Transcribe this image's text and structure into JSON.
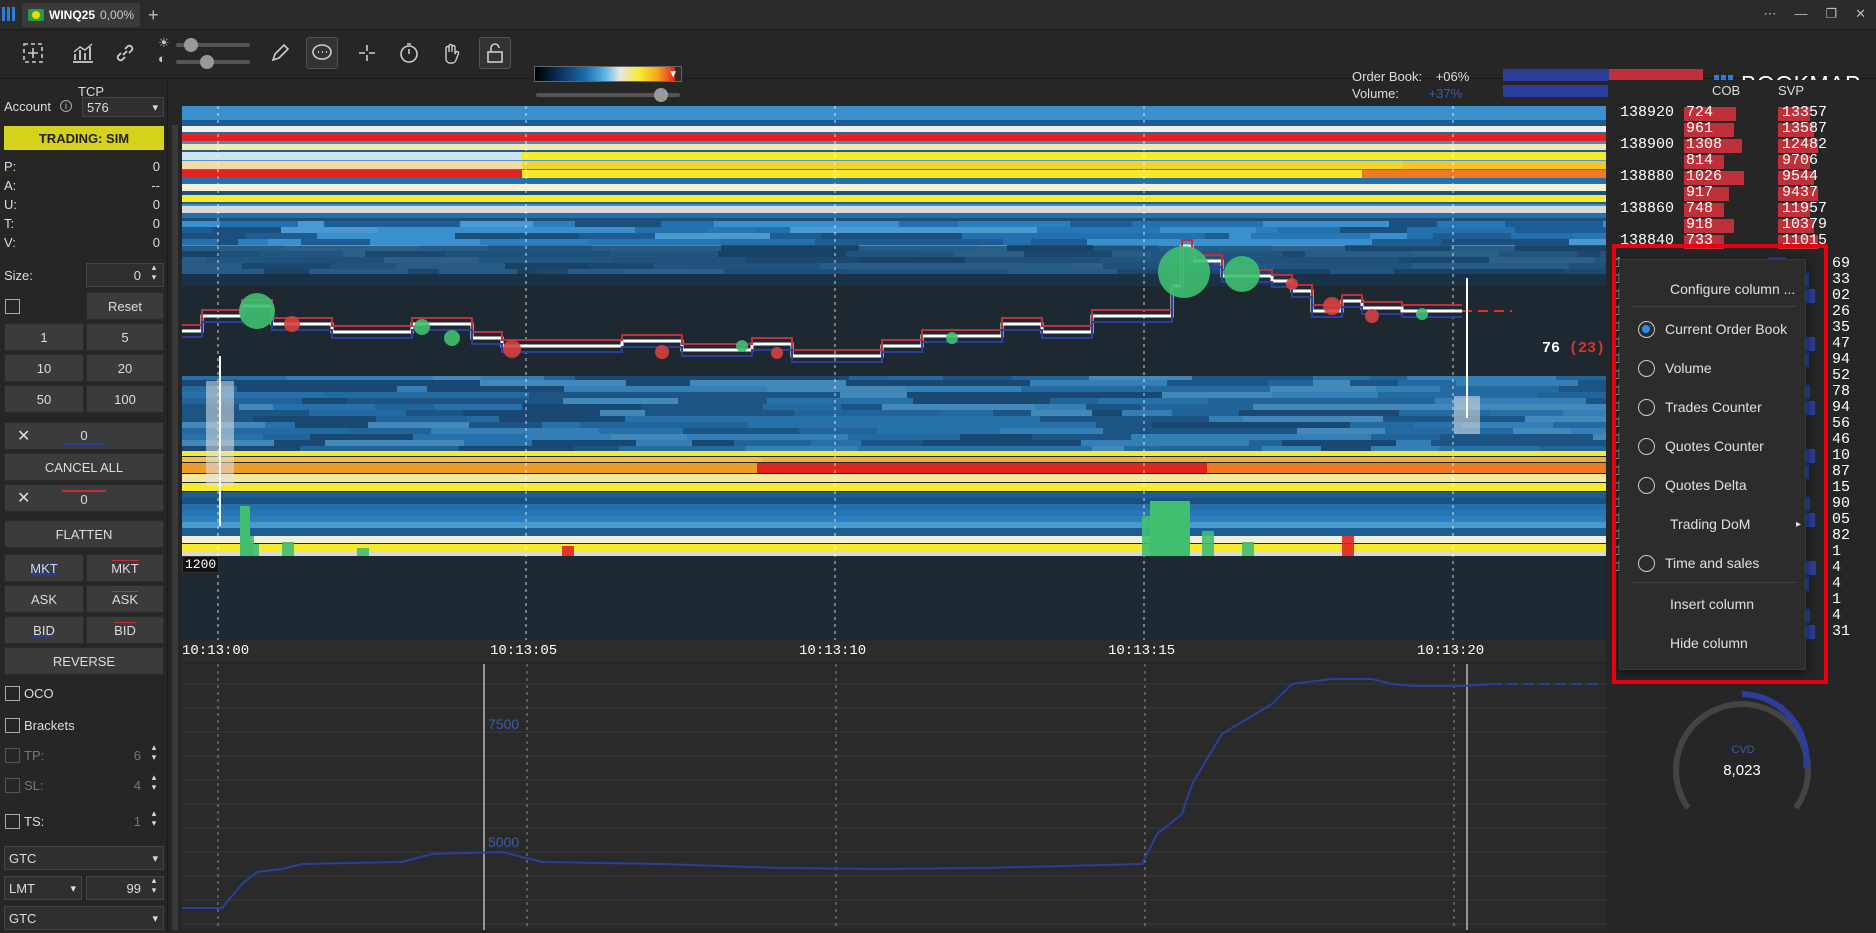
{
  "titlebar": {
    "instrument": "WINQ25",
    "change": "0,00%",
    "add_tab": "+"
  },
  "toolbar": {
    "order_book_label": "Order Book:",
    "order_book_value": "+06%",
    "volume_label": "Volume:",
    "volume_value": "+37%",
    "logo_text": "BOOKMAP"
  },
  "left_panel": {
    "tcp_label": "TCP",
    "account_label": "Account",
    "account_value": "576",
    "trading_mode": "TRADING: SIM",
    "stats": [
      {
        "label": "P:",
        "value": "0"
      },
      {
        "label": "A:",
        "value": "--"
      },
      {
        "label": "U:",
        "value": "0"
      },
      {
        "label": "T:",
        "value": "0"
      },
      {
        "label": "V:",
        "value": "0"
      }
    ],
    "size_label": "Size:",
    "size_value": "0",
    "reset_label": "Reset",
    "qty_buttons": [
      "1",
      "5",
      "10",
      "20",
      "50",
      "100"
    ],
    "cancel_buy_qty": "0",
    "cancel_all_label": "CANCEL ALL",
    "cancel_sell_qty": "0",
    "flatten_label": "FLATTEN",
    "mkt_label": "MKT",
    "ask_label": "ASK",
    "bid_label": "BID",
    "reverse_label": "REVERSE",
    "oco_label": "OCO",
    "brackets_label": "Brackets",
    "tp_label": "TP:",
    "tp_value": "6",
    "sl_label": "SL:",
    "sl_value": "4",
    "ts_label": "TS:",
    "ts_value": "1",
    "tif_top": "GTC",
    "order_type": "LMT",
    "offset": "99",
    "tif_bottom": "GTC"
  },
  "chart": {
    "volume_scale_label": "1200",
    "time_labels": [
      "10:13:00",
      "10:13:05",
      "10:13:10",
      "10:13:15",
      "10:13:20"
    ],
    "last_price_suffix": "76",
    "last_price_count": "(23)",
    "indicator_labels": [
      "7500",
      "5000"
    ]
  },
  "right_panel": {
    "cob_header": "COB",
    "svp_header": "SVP",
    "price_ladder": [
      {
        "price": "138920",
        "cob": "724",
        "svp": "13357"
      },
      {
        "price": "",
        "cob": "961",
        "svp": "13587"
      },
      {
        "price": "138900",
        "cob": "1308",
        "svp": "12482"
      },
      {
        "price": "",
        "cob": "814",
        "svp": "9706"
      },
      {
        "price": "138880",
        "cob": "1026",
        "svp": "9544"
      },
      {
        "price": "",
        "cob": "917",
        "svp": "9437"
      },
      {
        "price": "138860",
        "cob": "748",
        "svp": "11957"
      },
      {
        "price": "",
        "cob": "918",
        "svp": "10379"
      },
      {
        "price": "138840",
        "cob": "733",
        "svp": "11015"
      }
    ],
    "svp_partial": [
      "69",
      "33",
      "02",
      "26",
      "35",
      "47",
      "94",
      "52",
      "78",
      "94",
      "56",
      "46",
      "10",
      "87",
      "15",
      "90",
      "05",
      "82",
      "1",
      "4",
      "4",
      "1",
      "4",
      "31"
    ],
    "ladder_left_digit": "1",
    "cvd_label": "CVD",
    "cvd_value": "8,023"
  },
  "context_menu": {
    "configure": "Configure column ...",
    "current_order_book": "Current Order Book",
    "volume": "Volume",
    "trades_counter": "Trades Counter",
    "quotes_counter": "Quotes Counter",
    "quotes_delta": "Quotes Delta",
    "trading_dom": "Trading DoM",
    "time_and_sales": "Time and sales",
    "insert_column": "Insert column",
    "hide_column": "Hide column"
  },
  "colors": {
    "accent_blue": "#2a7ed8",
    "trading_yellow": "#d6d21b",
    "ask_red": "#c0303a",
    "bid_blue": "#2c3e9c",
    "highlight_red": "#e60012"
  }
}
